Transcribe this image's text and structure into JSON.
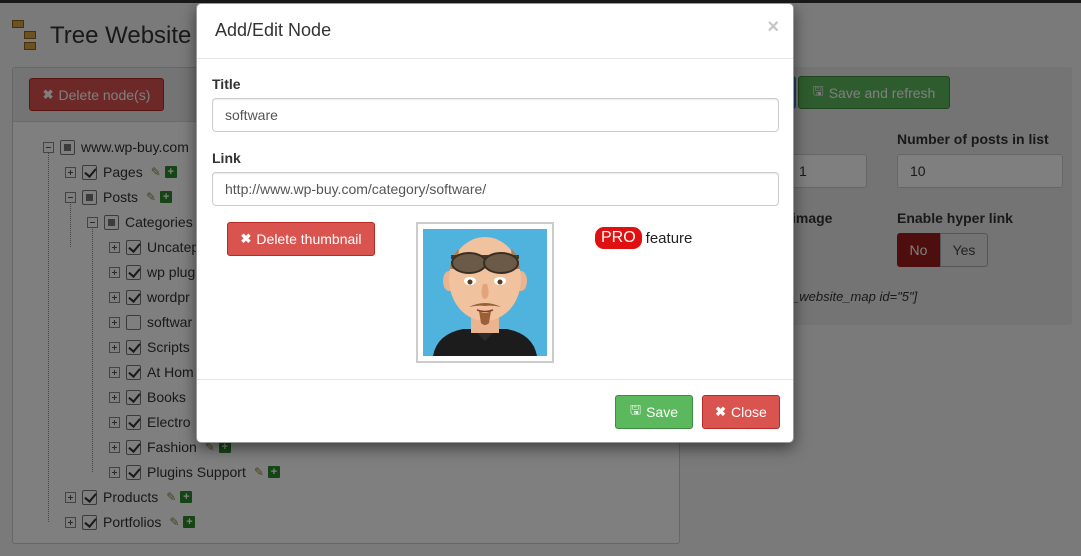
{
  "page": {
    "title": "Tree Website",
    "delete_nodes_label": "Delete node(s)",
    "save_refresh_label": "Save and refresh"
  },
  "tree": {
    "root": "www.wp-buy.com",
    "nodes": [
      {
        "label": "Pages",
        "checked": true
      },
      {
        "label": "Posts",
        "checked": "partial"
      },
      {
        "label": "Categories",
        "checked": "partial"
      },
      {
        "label": "Uncatep"
      },
      {
        "label": "wp plug"
      },
      {
        "label": "wordpr"
      },
      {
        "label": "softwar"
      },
      {
        "label": "Scripts"
      },
      {
        "label": "At Hom"
      },
      {
        "label": "Books"
      },
      {
        "label": "Electro"
      },
      {
        "label": "Fashion"
      },
      {
        "label": "Plugins Support"
      },
      {
        "label": "Products"
      },
      {
        "label": "Portfolios"
      }
    ]
  },
  "settings": {
    "partial_input_value": "1",
    "posts_in_list_label": "Number of posts in list",
    "posts_in_list_value": "10",
    "image_label_partial": "image",
    "hyperlink_label": "Enable hyper link",
    "toggle_no": "No",
    "toggle_yes": "Yes",
    "shortcode": "_website_map id=\"5\"]"
  },
  "modal": {
    "title": "Add/Edit Node",
    "close_glyph": "×",
    "title_label": "Title",
    "title_value": "software",
    "link_label": "Link",
    "link_value": "http://www.wp-buy.com/category/software/",
    "delete_thumbnail_label": "Delete thumbnail",
    "pro_badge": "PRO",
    "pro_text": "feature",
    "save_label": "Save",
    "close_label": "Close"
  },
  "colors": {
    "danger": "#d9534f",
    "success": "#5cb85c",
    "pro": "#e01010",
    "toggle_active": "#9c1c1c"
  },
  "icons": [
    "tree-logo-icon",
    "times-icon",
    "floppy-icon",
    "edit-icon",
    "plus-icon"
  ]
}
